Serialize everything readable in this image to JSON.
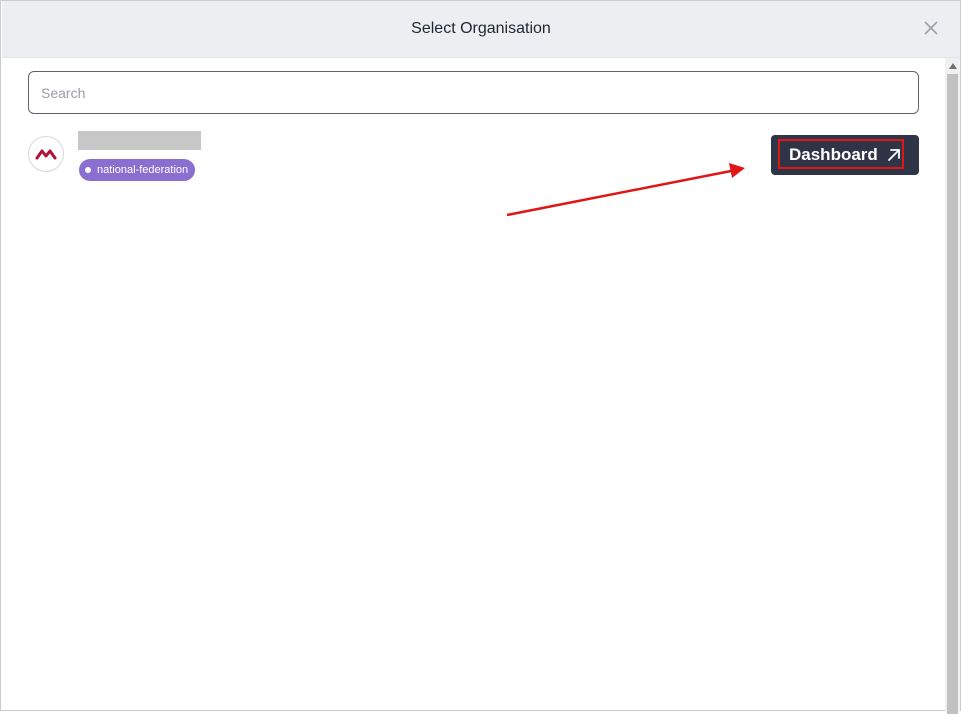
{
  "dialog": {
    "title": "Select Organisation"
  },
  "search": {
    "placeholder": "Search",
    "value": ""
  },
  "organisations": [
    {
      "tag": "national-federation",
      "action_label": "Dashboard"
    }
  ],
  "colors": {
    "header_bg": "#eceef1",
    "tag_bg": "#8a6fd1",
    "button_bg": "#2f3547",
    "annotation_red": "#e01616",
    "logo_red": "#b0123a"
  },
  "icons": {
    "close": "close-icon",
    "logo": "organisation-logo-icon",
    "external": "external-link-arrow-icon"
  }
}
